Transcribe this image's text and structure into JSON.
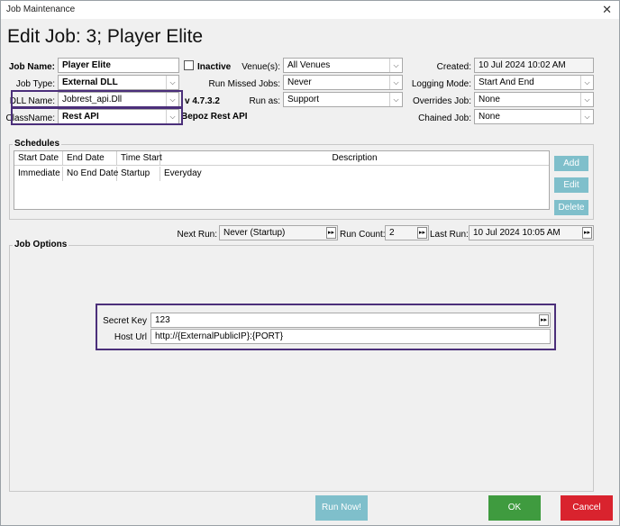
{
  "window": {
    "title": "Job Maintenance",
    "close": "✕"
  },
  "heading": "Edit Job: 3; Player Elite",
  "form": {
    "job_name_label": "Job Name:",
    "job_name": "Player Elite",
    "inactive_label": "Inactive",
    "job_type_label": "Job Type:",
    "job_type": "External DLL",
    "dll_name_label": "DLL Name:",
    "dll_name": "Jobrest_api.Dll",
    "classname_label": "ClassName:",
    "classname": "Rest API",
    "version": "v 4.7.3.2",
    "class_desc": "Bepoz Rest API",
    "venues_label": "Venue(s):",
    "venues": "All Venues",
    "run_missed_label": "Run Missed Jobs:",
    "run_missed": "Never",
    "run_as_label": "Run as:",
    "run_as": "Support",
    "created_label": "Created:",
    "created": "10 Jul 2024 10:02 AM",
    "logging_label": "Logging Mode:",
    "logging": "Start And End",
    "overrides_label": "Overrides Job:",
    "overrides": "None",
    "chained_label": "Chained Job:",
    "chained": "None"
  },
  "schedules": {
    "title": "Schedules",
    "columns": [
      "Start Date",
      "End Date",
      "Time Start",
      "Description"
    ],
    "rows": [
      [
        "Immediate",
        "No End Date",
        "Startup",
        "Everyday"
      ]
    ],
    "add": "Add",
    "edit": "Edit",
    "delete": "Delete"
  },
  "run": {
    "next_run_label": "Next Run:",
    "next_run": "Never (Startup)",
    "run_count_label": "Run Count:",
    "run_count": "2",
    "last_run_label": "Last Run:",
    "last_run": "10 Jul 2024 10:05 AM"
  },
  "job_options": {
    "title": "Job Options",
    "secret_key_label": "Secret Key",
    "secret_key": "123",
    "host_url_label": "Host Url",
    "host_url": "http://{ExternalPublicIP}:{PORT}"
  },
  "buttons": {
    "run_now": "Run Now!",
    "ok": "OK",
    "cancel": "Cancel"
  },
  "colors": {
    "highlight": "#4b2f7a",
    "teal": "#7fbfcb",
    "ok": "#3f9b3f",
    "cancel": "#d9232e"
  }
}
